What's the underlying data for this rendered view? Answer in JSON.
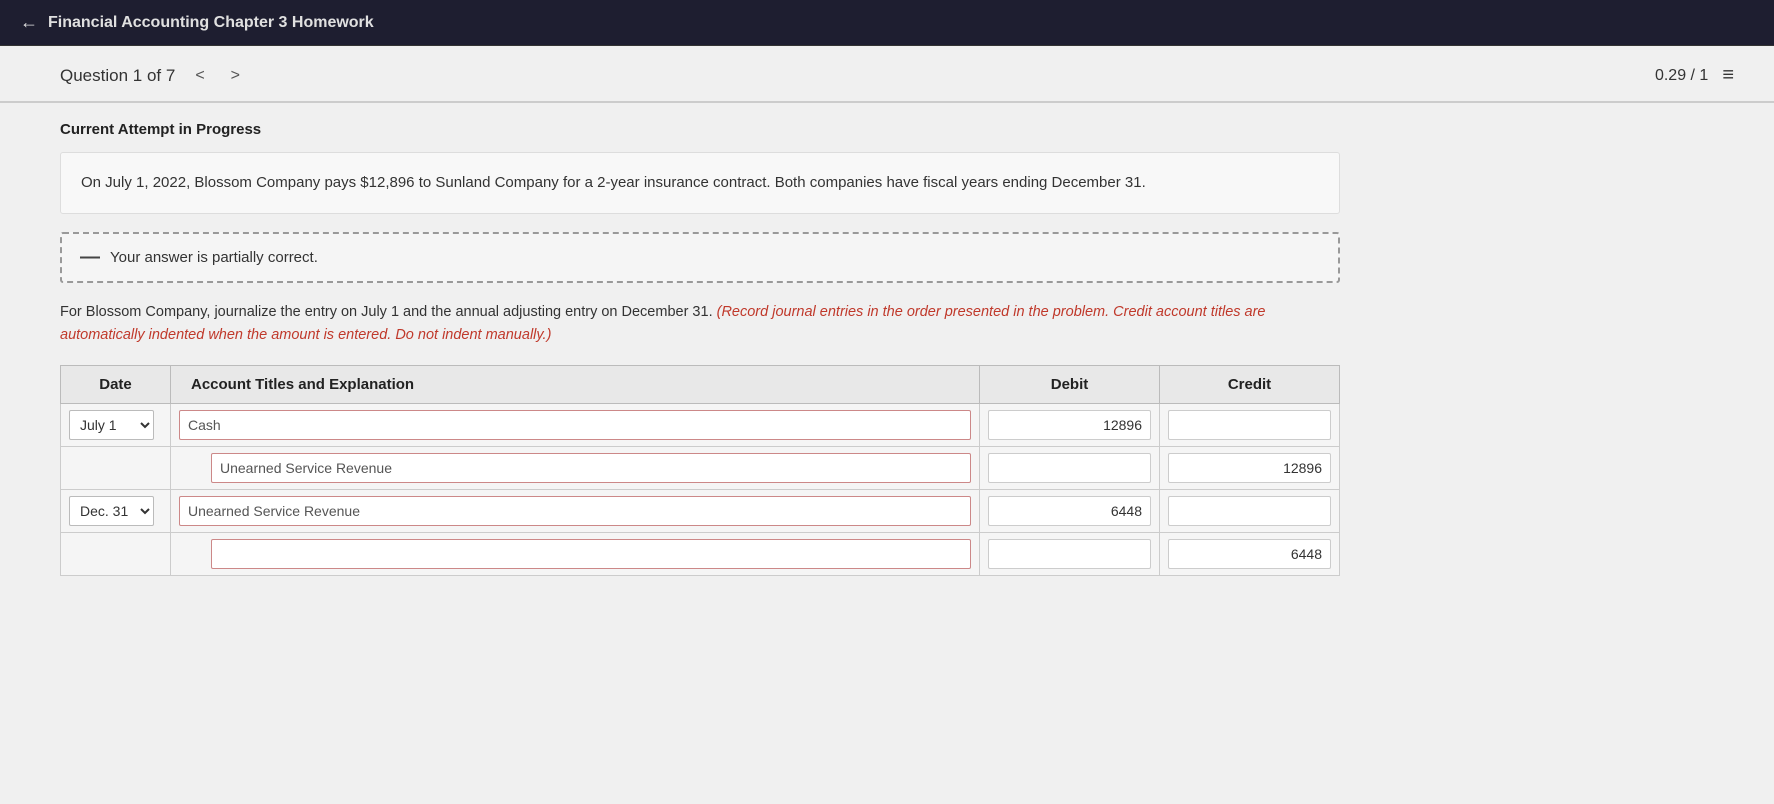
{
  "topbar": {
    "back_label": "←",
    "title": "Financial Accounting Chapter 3 Homework"
  },
  "header": {
    "question_label": "Question 1 of 7",
    "nav_prev": "<",
    "nav_next": ">",
    "score": "0.29 / 1",
    "menu_icon": "≡"
  },
  "attempt": {
    "label": "Current Attempt in Progress"
  },
  "problem": {
    "text": "On July 1, 2022, Blossom Company pays $12,896 to Sunland Company for a 2-year insurance contract. Both companies have fiscal years ending December 31."
  },
  "partial_correct": {
    "icon": "—",
    "message": "Your answer is partially correct."
  },
  "instruction": {
    "plain": "For Blossom Company, journalize the entry on July 1 and the annual adjusting entry on December 31. ",
    "red_italic": "(Record journal entries in the order presented in the problem. Credit account titles are automatically indented when the amount is entered. Do not indent manually.)"
  },
  "table": {
    "headers": [
      "Date",
      "Account Titles and Explanation",
      "Debit",
      "Credit"
    ],
    "rows": [
      {
        "date": "July 1",
        "date_dropdown": true,
        "account": "Cash",
        "debit": "12896",
        "credit": "",
        "indent": false
      },
      {
        "date": "",
        "date_dropdown": false,
        "account": "Unearned Service Revenue",
        "debit": "",
        "credit": "12896",
        "indent": true
      },
      {
        "date": "Dec. 31",
        "date_dropdown": true,
        "account": "Unearned Service Revenue",
        "debit": "6448",
        "credit": "",
        "indent": false
      },
      {
        "date": "",
        "date_dropdown": false,
        "account": "",
        "debit": "",
        "credit": "6448",
        "indent": true
      }
    ]
  }
}
